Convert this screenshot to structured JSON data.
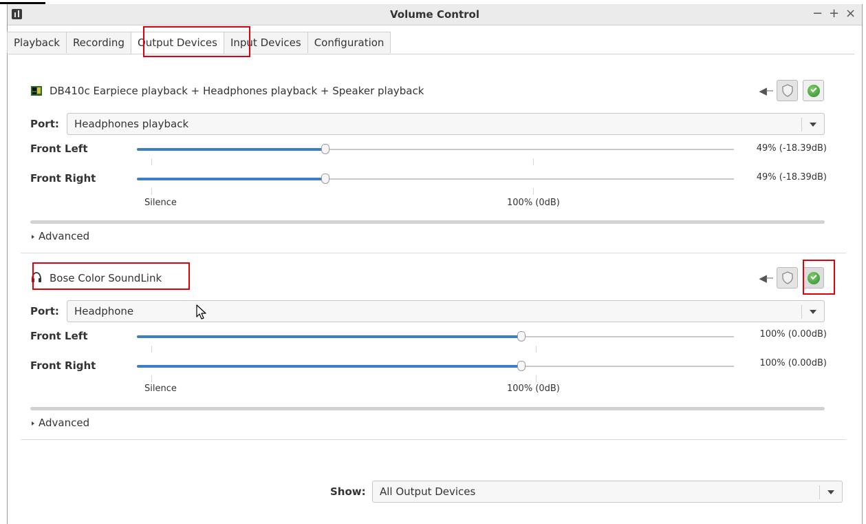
{
  "window": {
    "title": "Volume Control",
    "controls": {
      "minimize": "−",
      "maximize": "+",
      "close": "×"
    }
  },
  "tabs": [
    {
      "label": "Playback",
      "active": false
    },
    {
      "label": "Recording",
      "active": false
    },
    {
      "label": "Output Devices",
      "active": true
    },
    {
      "label": "Input Devices",
      "active": false
    },
    {
      "label": "Configuration",
      "active": false
    }
  ],
  "devices": [
    {
      "name": "DB410c Earpiece playback + Headphones playback + Speaker playback",
      "icon": "sound-card-icon",
      "port_label": "Port:",
      "port_value": "Headphones playback",
      "default_selected": false,
      "channels": [
        {
          "label": "Front Left",
          "value_text": "49% (-18.39dB)",
          "percent": 49
        },
        {
          "label": "Front Right",
          "value_text": "49% (-18.39dB)",
          "percent": 49
        }
      ],
      "scale": {
        "silence": "Silence",
        "full": "100% (0dB)"
      },
      "advanced_label": "Advanced"
    },
    {
      "name": "Bose Color SoundLink",
      "icon": "headphones-icon",
      "port_label": "Port:",
      "port_value": "Headphone",
      "default_selected": true,
      "channels": [
        {
          "label": "Front Left",
          "value_text": "100% (0.00dB)",
          "percent": 100
        },
        {
          "label": "Front Right",
          "value_text": "100% (0.00dB)",
          "percent": 100
        }
      ],
      "scale": {
        "silence": "Silence",
        "full": "100% (0dB)"
      },
      "advanced_label": "Advanced"
    }
  ],
  "footer": {
    "show_label": "Show:",
    "show_value": "All Output Devices"
  },
  "colors": {
    "accent": "#3e7fc2",
    "highlight": "#e0000b",
    "check_green": "#2f8a2a"
  }
}
